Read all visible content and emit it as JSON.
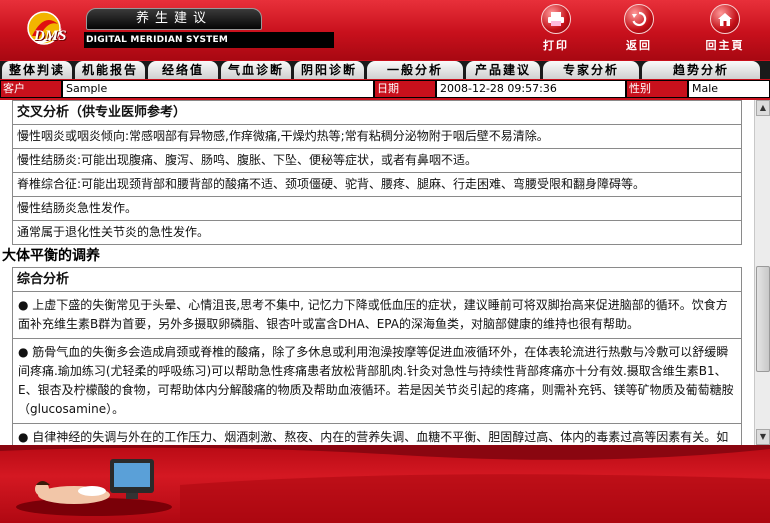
{
  "header": {
    "title": "养生建议",
    "logo_text": "DMS",
    "subtitle": "DIGITAL MERIDIAN SYSTEM",
    "buttons": [
      {
        "label": "打印",
        "icon": "printer-icon"
      },
      {
        "label": "返回",
        "icon": "back-icon"
      },
      {
        "label": "回主頁",
        "icon": "home-icon"
      }
    ]
  },
  "nav": {
    "tabs": [
      "整体判读",
      "机能报告",
      "经络值",
      "气血诊断",
      "阴阳诊断",
      "一般分析",
      "产品建议",
      "专家分析",
      "趋势分析"
    ]
  },
  "info": {
    "client_label": "客户",
    "client_value": "Sample",
    "date_label": "日期",
    "date_value": "2008-12-28 09:57:36",
    "gender_label": "性别",
    "gender_value": "Male"
  },
  "content": {
    "cross_title": "交叉分析（供专业医师参考）",
    "cross_rows": [
      "慢性咽炎或咽炎倾向:常感咽部有异物感,作痒微痛,干燥灼热等;常有粘稠分泌物附于咽后壁不易清除。",
      "慢性结肠炎:可能出现腹痛、腹泻、肠鸣、腹胀、下坠、便秘等症状，或者有鼻咽不适。",
      "脊椎综合征:可能出现颈背部和腰背部的酸痛不适、颈项僵硬、驼背、腰疼、腿麻、行走困难、弯腰受限和翻身障碍等。",
      "慢性结肠炎急性发作。",
      "通常属于退化性关节炎的急性发作。"
    ],
    "balance_title": "大体平衡的调养",
    "summary_title": "综合分析",
    "paragraphs": [
      "● 上虚下盛的失衡常见于头晕、心情沮丧,思考不集中, 记忆力下降或低血压的症状，建议睡前可将双脚抬高来促进脑部的循环。饮食方面补充维生素B群为首要，另外多摄取卵磷脂、银杏叶或富含DHA、EPA的深海鱼类，对脑部健康的维持也很有帮助。",
      "● 筋骨气血的失衡多会造成肩颈或脊椎的酸痛，除了多休息或利用泡澡按摩等促进血液循环外，在体表轮流进行热敷与冷敷可以舒缓瞬间疼痛.瑜加练习(尤轻柔的呼吸练习)可以帮助急性疼痛患者放松背部肌肉.针灸对急性与持续性背部疼痛亦十分有效.摄取含维生素B1、E、银杏及柠檬酸的食物，可帮助体内分解酸痛的物质及帮助血液循环。若是因关节炎引起的疼痛，则需补充钙、镁等矿物质及葡萄糖胺（glucosamine）。",
      "● 自律神经的失调与外在的工作压力、烟酒刺激、熬夜、内在的营养失调、血糖不平衡、胆固醇过高、体内的毒素过高等因素有关。如不注意会导致体重变化、胃肠失调、便秘、偏头痛、失眠及引起免疫力下降等的症状，学会控制情绪,舒缓压力,每日三餐应定时，以"
    ]
  },
  "colors": {
    "brand_red": "#c8101c",
    "nav_bg": "#1a1a1a"
  }
}
